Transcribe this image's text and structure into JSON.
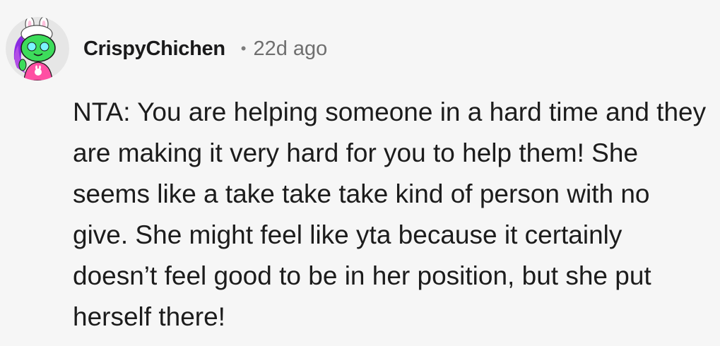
{
  "comment": {
    "author": "CrispyChichen",
    "separator": "•",
    "timestamp": "22d ago",
    "avatar_icon": "snoo-avatar-bunny-hat-icon",
    "body": "NTA: You are helping someone in a hard time and they are making it very hard for you to help them! She seems like a take take take kind of person with no give. She might feel like yta because it certainly doesn’t feel good to be in her position, but she put herself there!"
  },
  "colors": {
    "background": "#f6f6f6",
    "text": "#1c1c1c",
    "meta": "#6f6f6f",
    "avatar_bg": "#e6e6e6",
    "avatar_green": "#3ddc5b",
    "avatar_purple": "#8a2be2",
    "avatar_pink": "#ff4fa3"
  }
}
